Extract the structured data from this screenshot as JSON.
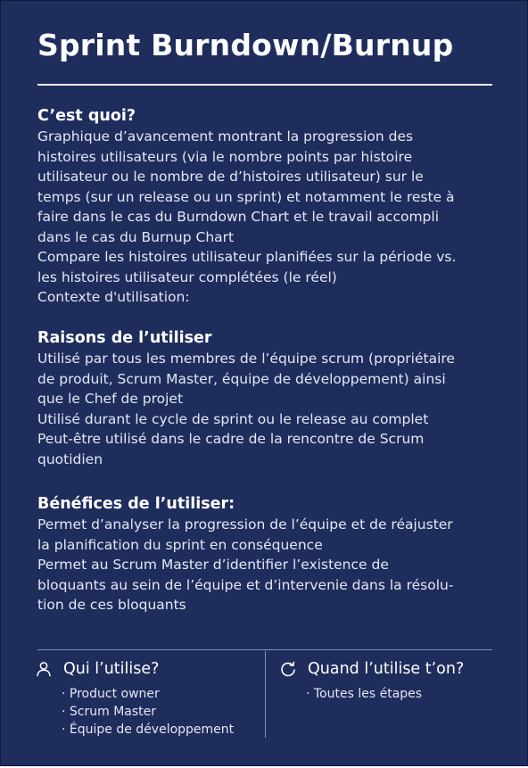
{
  "title": "Sprint Burndown/Burnup",
  "what": {
    "heading": "C’est quoi?",
    "lines": [
      "Graphique d’avancement montrant la progression des",
      "histoires utilisateurs (via le nombre points par histoire",
      "utilisateur ou le nombre de d’histoires utilisateur) sur le",
      "temps (sur un release ou un sprint) et notamment le reste à",
      "faire dans le cas du Burndown Chart et le travail accompli",
      "dans le cas du Burnup Chart",
      "Compare les histoires utilisateur planifiées sur la période vs.",
      "les histoires utilisateur complétées (le réel)",
      "Contexte d'utilisation:"
    ]
  },
  "why": {
    "heading": "Raisons de l’utiliser",
    "lines": [
      "Utilisé par tous les membres de l’équipe scrum (propriétaire",
      "de produit, Scrum Master, équipe de développement) ainsi",
      "que le Chef de projet",
      "Utilisé durant le cycle de sprint ou le release au complet",
      "Peut-être utilisé dans le cadre de la rencontre de Scrum",
      "quotidien"
    ]
  },
  "benefits": {
    "heading": "Bénéfices de l’utiliser:",
    "lines": [
      "Permet d’analyser la progression de l’équipe et de réajuster",
      "la planification du sprint en conséquence",
      "Permet au Scrum Master d’identifier l’existence de",
      "bloquants au sein de l’équipe et d’intervenie dans la résolu-",
      "tion de ces bloquants"
    ]
  },
  "who": {
    "icon": "person-icon",
    "heading": "Qui l’utilise?",
    "items": [
      "Product owner",
      "Scrum Master",
      "Équipe de développement"
    ]
  },
  "when": {
    "icon": "cycle-icon",
    "heading": "Quand l’utilise t’on?",
    "items": [
      "Toutes les étapes"
    ]
  },
  "colors": {
    "background": "#1f2d5d",
    "text": "#ffffff",
    "divider": "#8a93b3"
  }
}
